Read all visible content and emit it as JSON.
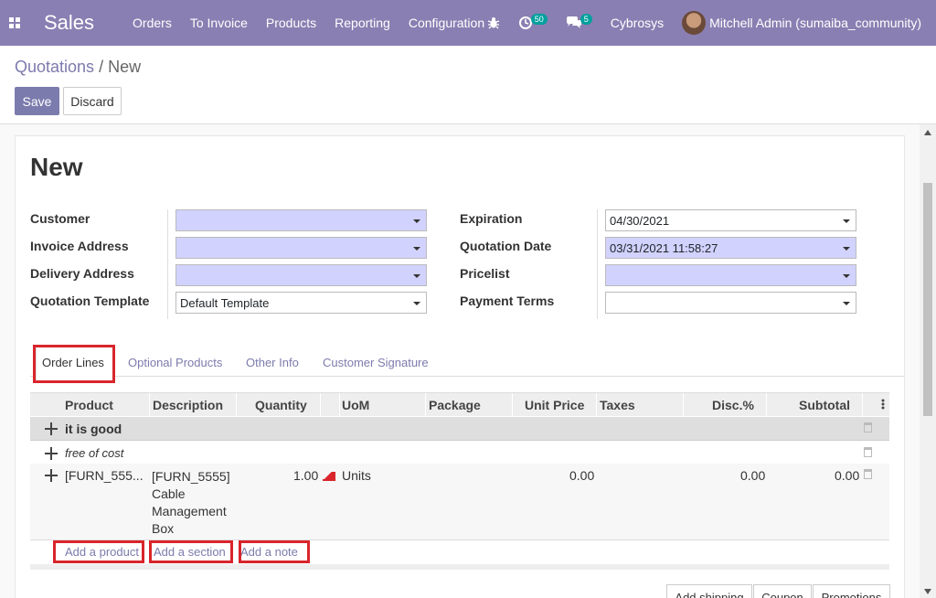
{
  "navbar": {
    "app_name": "Sales",
    "menu": [
      "Orders",
      "To Invoice",
      "Products",
      "Reporting",
      "Configuration"
    ],
    "activity_count": "50",
    "messages_count": "5",
    "company": "Cybrosys",
    "user": "Mitchell Admin (sumaiba_community)"
  },
  "breadcrumb": {
    "parent": "Quotations",
    "separator": "/",
    "current": "New"
  },
  "buttons": {
    "save": "Save",
    "discard": "Discard"
  },
  "form": {
    "title": "New",
    "left_fields": [
      {
        "label": "Customer",
        "value": ""
      },
      {
        "label": "Invoice Address",
        "value": ""
      },
      {
        "label": "Delivery Address",
        "value": ""
      },
      {
        "label": "Quotation Template",
        "value": "Default Template"
      }
    ],
    "right_fields": [
      {
        "label": "Expiration",
        "value": "04/30/2021"
      },
      {
        "label": "Quotation Date",
        "value": "03/31/2021 11:58:27"
      },
      {
        "label": "Pricelist",
        "value": ""
      },
      {
        "label": "Payment Terms",
        "value": ""
      }
    ]
  },
  "tabs": [
    "Order Lines",
    "Optional Products",
    "Other Info",
    "Customer Signature"
  ],
  "table": {
    "headers": [
      "Product",
      "Description",
      "Quantity",
      "UoM",
      "Package",
      "Unit Price",
      "Taxes",
      "Disc.%",
      "Subtotal"
    ],
    "section_row": "it is good",
    "note_row": "free of cost",
    "product_row": {
      "product": "[FURN_555...",
      "description": [
        "[FURN_5555]",
        "Cable",
        "Management",
        "Box"
      ],
      "quantity": "1.00",
      "uom": "Units",
      "unit_price": "0.00",
      "discount": "0.00",
      "subtotal": "0.00"
    },
    "add_links": [
      "Add a product",
      "Add a section",
      "Add a note"
    ]
  },
  "bottom_buttons": [
    "Add shipping",
    "Coupon",
    "Promotions"
  ],
  "colors": {
    "brand": "#8a7fb2",
    "accent": "#7c7bad",
    "required": "#d2d2ff",
    "highlight": "#d9252b"
  }
}
